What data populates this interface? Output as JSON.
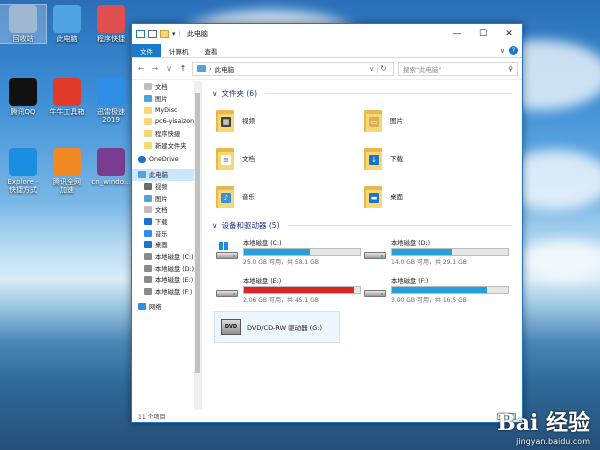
{
  "desktop": {
    "icons": [
      {
        "label": "回收站",
        "icon": "recycle-bin-icon",
        "color": "#9fb8cf"
      },
      {
        "label": "此电脑",
        "icon": "computer-icon",
        "color": "#4fa3e0"
      },
      {
        "label": "程序快捷",
        "icon": "shortcut-icon",
        "color": "#e05050"
      },
      {
        "label": "腾讯QQ",
        "icon": "qq-penguin-icon",
        "color": "#111111"
      },
      {
        "label": "牛牛工具箱",
        "icon": "cow-app-icon",
        "color": "#e23a2a"
      },
      {
        "label": "迅雷极速\n2019",
        "icon": "thunder-bird-icon",
        "color": "#2f8fe8"
      },
      {
        "label": "Explore -\n快捷方式",
        "icon": "ie-icon",
        "color": "#1a8fe0"
      },
      {
        "label": "腾讯全网\n加速",
        "icon": "accelerator-icon",
        "color": "#f08a24"
      },
      {
        "label": "cn_windo...",
        "icon": "winrar-icon",
        "color": "#7a3c8f"
      }
    ]
  },
  "window": {
    "title": "此电脑",
    "controls": {
      "minimize": "—",
      "maximize": "☐",
      "close": "✕"
    },
    "ribbon": {
      "tabs": [
        "文件",
        "计算机",
        "查看"
      ],
      "expand": "∨",
      "help": "?"
    },
    "address": {
      "path": "此电脑",
      "separator": "›"
    },
    "search": {
      "placeholder": "搜索\"此电脑\""
    }
  },
  "nav_pane": {
    "quick_access": [
      {
        "label": "文档",
        "color": "#bfbfbf",
        "pinned": true
      },
      {
        "label": "图片",
        "color": "#4fa3e0",
        "pinned": true
      },
      {
        "label": "MyDisc",
        "color": "#f8d775"
      },
      {
        "label": "pc6-yisaizonghe",
        "color": "#f8d775"
      },
      {
        "label": "程序快捷",
        "color": "#f8d775"
      },
      {
        "label": "新建文件夹",
        "color": "#f8d775"
      }
    ],
    "onedrive": "OneDrive",
    "this_pc": "此电脑",
    "pc_items": [
      {
        "label": "视频",
        "color": "#6b6b6b"
      },
      {
        "label": "图片",
        "color": "#4fa3e0"
      },
      {
        "label": "文档",
        "color": "#bfbfbf"
      },
      {
        "label": "下载",
        "color": "#1a73c9"
      },
      {
        "label": "音乐",
        "color": "#2f8fe8"
      },
      {
        "label": "桌面",
        "color": "#1a73c9"
      },
      {
        "label": "本地磁盘 (C:)",
        "color": "#8a8a8a"
      },
      {
        "label": "本地磁盘 (D:)",
        "color": "#8a8a8a"
      },
      {
        "label": "本地磁盘 (E:)",
        "color": "#8a8a8a"
      },
      {
        "label": "本地磁盘 (F:)",
        "color": "#8a8a8a"
      }
    ],
    "network": "网络"
  },
  "content": {
    "folders_header": "文件夹 (6)",
    "folders": [
      {
        "label": "视频",
        "badge_color": "#444444",
        "badge": "▦"
      },
      {
        "label": "图片",
        "badge_color": "#d8b057",
        "badge": "▭"
      },
      {
        "label": "文档",
        "badge_color": "#ffffff",
        "badge": "≡"
      },
      {
        "label": "下载",
        "badge_color": "#1a73c9",
        "badge": "↓"
      },
      {
        "label": "音乐",
        "badge_color": "#3a8fd8",
        "badge": "♪"
      },
      {
        "label": "桌面",
        "badge_color": "#1a73c9",
        "badge": "▬"
      }
    ],
    "drives_header": "设备和驱动器 (5)",
    "drives": [
      {
        "label": "本地磁盘 (C:)",
        "used_fraction": 0.57,
        "bar_color": "#26a0da",
        "size_text": "25.0 GB 可用，共 58.1 GB",
        "system": true
      },
      {
        "label": "本地磁盘 (D:)",
        "used_fraction": 0.52,
        "bar_color": "#26a0da",
        "size_text": "14.0 GB 可用，共 29.1 GB",
        "system": false
      },
      {
        "label": "本地磁盘 (E:)",
        "used_fraction": 0.95,
        "bar_color": "#da2626",
        "size_text": "2.06 GB 可用，共 45.1 GB",
        "system": false
      },
      {
        "label": "本地磁盘 (F:)",
        "used_fraction": 0.82,
        "bar_color": "#26a0da",
        "size_text": "3.00 GB 可用，共 16.5 GB",
        "system": false
      }
    ],
    "dvd": {
      "label": "DVD/CD-RW 驱动器 (G:)",
      "icon_text": "DVD"
    }
  },
  "status": {
    "count": "11 个项目"
  },
  "watermark": {
    "logo": "Bai 经验",
    "url": "jingyan.baidu.com"
  }
}
